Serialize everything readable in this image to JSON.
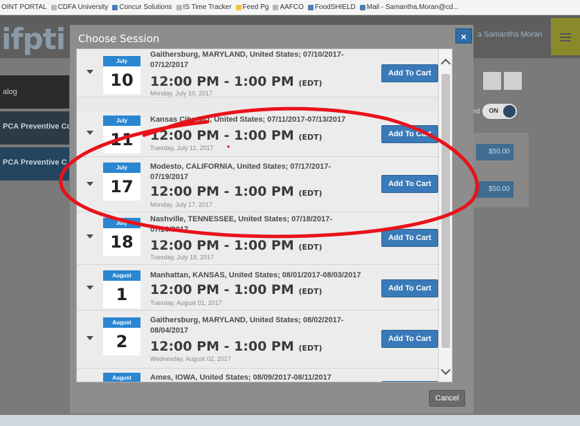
{
  "bookmarks": [
    {
      "label": "OINT PORTAL",
      "icon": "bookmark-icon"
    },
    {
      "label": "CDFA University",
      "icon": "doc-icon"
    },
    {
      "label": "Concur Solutions",
      "icon": "concur-icon"
    },
    {
      "label": "IS Time Tracker",
      "icon": "doc-icon"
    },
    {
      "label": "Feed Pg",
      "icon": "folder-icon"
    },
    {
      "label": "AAFCO",
      "icon": "doc-icon"
    },
    {
      "label": "FoodSHIELD",
      "icon": "shield-icon"
    },
    {
      "label": "Mail - Samantha.Moran@cd...",
      "icon": "mail-icon"
    }
  ],
  "background_page": {
    "logo": "ifpti",
    "user_link": "a Samantha Moran",
    "nav": {
      "catalog": "alog",
      "item_a": "PCA Preventive Co",
      "item_b": "PCA Preventive C"
    },
    "toggle_prefix": "led",
    "toggle_label": "ON",
    "prices": [
      "$50.00",
      "$50.00"
    ]
  },
  "modal": {
    "title": "Choose Session",
    "close_label": "×",
    "cancel_label": "Cancel",
    "add_label": "Add To Cart",
    "sessions": [
      {
        "month": "July",
        "day": "10",
        "location": "Gaithersburg, MARYLAND, United States; 07/10/2017-07/12/2017",
        "time": "12:00 PM - 1:00 PM",
        "tz": "(EDT)",
        "weekday": "Monday, July 10, 2017"
      },
      {
        "month": "July",
        "day": "11",
        "location": "Kansas City, MO, United States; 07/11/2017-07/13/2017",
        "time": "12:00 PM - 1:00 PM",
        "tz": "(EDT)",
        "weekday": "Tuesday, July 11, 2017"
      },
      {
        "month": "July",
        "day": "17",
        "location": "Modesto, CALIFORNIA, United States; 07/17/2017-07/19/2017",
        "time": "12:00 PM - 1:00 PM",
        "tz": "(EDT)",
        "weekday": "Monday, July 17, 2017"
      },
      {
        "month": "July",
        "day": "18",
        "location": "Nashville, TENNESSEE, United States; 07/18/2017-07/20/2017",
        "time": "12:00 PM - 1:00 PM",
        "tz": "(EDT)",
        "weekday": "Tuesday, July 18, 2017"
      },
      {
        "month": "August",
        "day": "1",
        "location": "Manhattan, KANSAS, United States; 08/01/2017-08/03/2017",
        "time": "12:00 PM - 1:00 PM",
        "tz": "(EDT)",
        "weekday": "Tuesday, August 01, 2017"
      },
      {
        "month": "August",
        "day": "2",
        "location": "Gaithersburg, MARYLAND, United States; 08/02/2017-08/04/2017",
        "time": "12:00 PM - 1:00 PM",
        "tz": "(EDT)",
        "weekday": "Wednesday, August 02, 2017"
      },
      {
        "month": "August",
        "day": "",
        "location": "Ames, IOWA, United States; 08/09/2017-08/11/2017",
        "time": "",
        "tz": "",
        "weekday": ""
      }
    ]
  },
  "colors": {
    "accent": "#2a86d1",
    "button": "#3a7ab8",
    "annotation": "#e8121a"
  }
}
